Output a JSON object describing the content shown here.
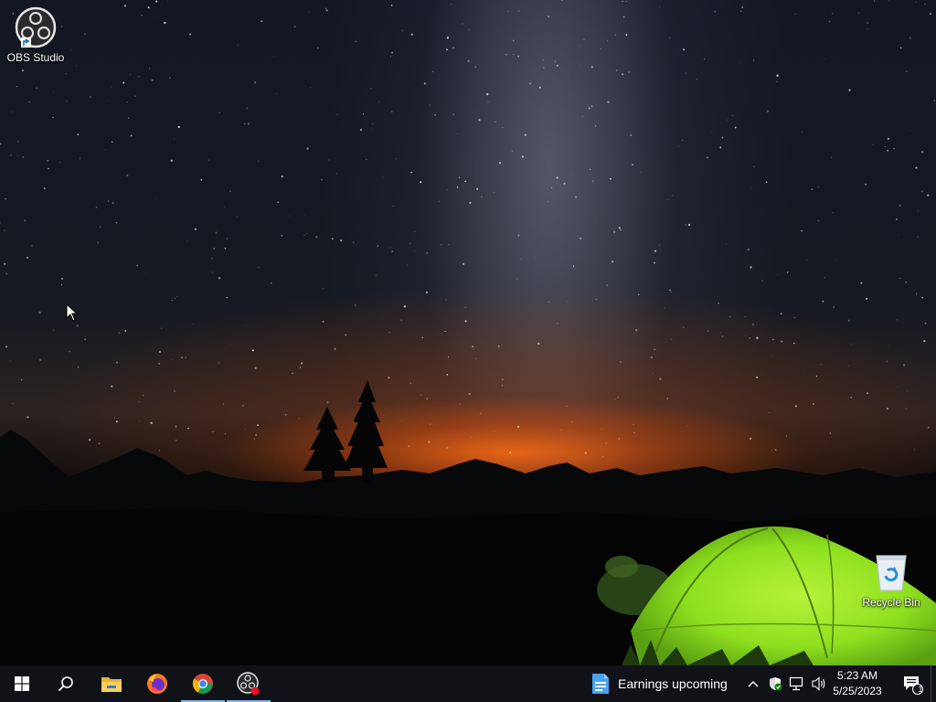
{
  "desktop": {
    "icons": [
      {
        "label": "OBS Studio",
        "icon": "obs-studio-icon"
      },
      {
        "label": "Recycle Bin",
        "icon": "recycle-bin-icon"
      }
    ]
  },
  "taskbar": {
    "apps": [
      {
        "name": "Start",
        "icon": "windows-logo-icon"
      },
      {
        "name": "Search",
        "icon": "search-icon"
      },
      {
        "name": "File Explorer",
        "icon": "folder-icon"
      },
      {
        "name": "Firefox",
        "icon": "firefox-icon"
      },
      {
        "name": "Google Chrome",
        "icon": "chrome-icon",
        "active": true
      },
      {
        "name": "OBS Studio",
        "icon": "obs-studio-icon",
        "active": true
      }
    ],
    "news": {
      "label": "Earnings upcoming",
      "icon": "stock-news-icon"
    },
    "tray": [
      "chevron-up-icon",
      "windows-security-icon",
      "network-icon",
      "volume-icon"
    ],
    "clock": {
      "time": "5:23 AM",
      "date": "5/25/2023"
    },
    "notifications": {
      "count": "1"
    }
  },
  "colors": {
    "taskbar": "#101218",
    "active_indicator": "#76b9ed",
    "tent": "#8fe01f"
  }
}
